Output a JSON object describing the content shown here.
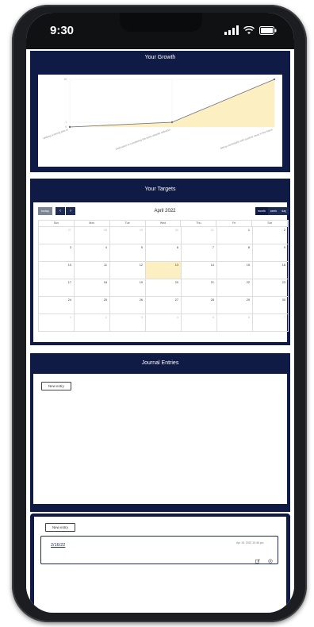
{
  "status": {
    "time": "9:30"
  },
  "growth": {
    "title": "Your Growth",
    "chart_data": {
      "type": "area",
      "title": "",
      "x": [
        "Making a strong plan to",
        "Dedication to completing the tasks despite setbacks",
        "Being comfortable with positive news in the future"
      ],
      "y_ticks": [
        "0",
        "1",
        "10"
      ],
      "ylim": [
        0,
        10
      ],
      "series": [
        {
          "values": [
            0,
            1,
            10
          ]
        }
      ],
      "fill_color": "#fcefc2",
      "line_color": "#6b7080",
      "grid": true
    }
  },
  "targets": {
    "title": "Your Targets",
    "toolbar": {
      "today": "today",
      "prev": "‹",
      "next": "›",
      "month_title": "April 2022",
      "views": [
        "month",
        "week",
        "day"
      ]
    },
    "weekdays": [
      "Sun",
      "Mon",
      "Tue",
      "Wed",
      "Thu",
      "Fri",
      "Sat"
    ],
    "weeks": [
      [
        "27",
        "28",
        "29",
        "30",
        "31",
        "1",
        "2"
      ],
      [
        "3",
        "4",
        "5",
        "6",
        "7",
        "8",
        "9"
      ],
      [
        "10",
        "11",
        "12",
        "13",
        "14",
        "15",
        "16"
      ],
      [
        "17",
        "18",
        "19",
        "20",
        "21",
        "22",
        "23"
      ],
      [
        "24",
        "25",
        "26",
        "27",
        "28",
        "29",
        "30"
      ],
      [
        "1",
        "2",
        "3",
        "4",
        "5",
        "6",
        "7"
      ]
    ],
    "today_cell": {
      "week": 2,
      "day": 3
    },
    "highlight_color": "#fcefc2"
  },
  "journal": {
    "title": "Journal Entries",
    "new_entry_label": "New entry"
  },
  "entries": {
    "new_entry_label": "New entry",
    "items": [
      {
        "date": "2/16/22",
        "timestamp": "Apr 15, 2022 10:46 pm"
      }
    ]
  },
  "colors": {
    "navy": "#101b45",
    "accent": "#1e2b55"
  }
}
